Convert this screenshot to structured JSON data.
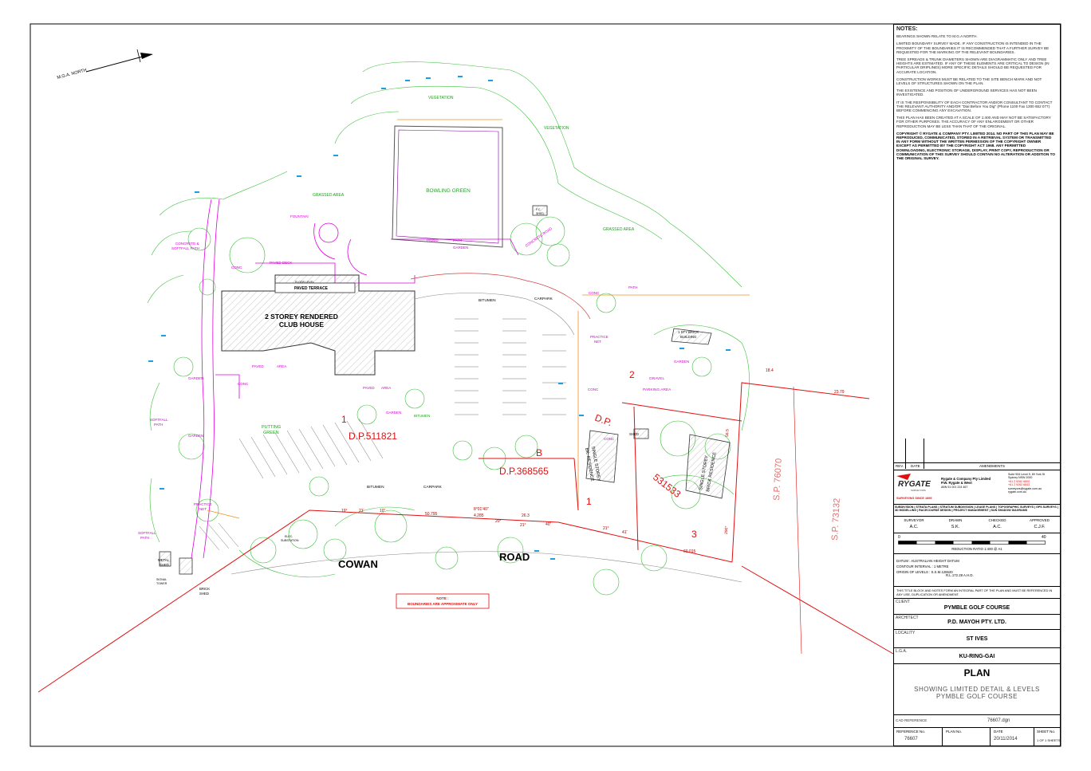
{
  "drawing": {
    "north_label": "M.G.A. NORTH",
    "club_house": [
      "2 STOREY RENDERED",
      "CLUB HOUSE"
    ],
    "paved_terrace": "PAVED TERRACE",
    "floor_level": [
      "FLOOR LEVEL"
    ],
    "bowling_green": "BOWLING GREEN",
    "putting_green": [
      "PUTTING",
      "GREEN"
    ],
    "vegetation": "VEGETATION",
    "grassed_area": "GRASSED AREA",
    "fountain": "FOUNTAIN",
    "paved_deck": "PAVED DECK",
    "paved_path": [
      "PAVED",
      "PATH"
    ],
    "garden": "GARDEN",
    "concrete_softfall_path": [
      "CONCRETE &",
      "SOFTFALL PATH"
    ],
    "softfall_path": [
      "SOFTFALL",
      "PATH"
    ],
    "paved_area": [
      "PAVED",
      "AREA"
    ],
    "conc": "CONC",
    "bitumen": "BITUMEN",
    "carpark": "CARPARK",
    "practice_net": [
      "PRACTICE",
      "NET"
    ],
    "gravel_parking": [
      "GRAVEL",
      "PARKING AREA"
    ],
    "brick_building": [
      "1 STY BRICK",
      "BUILDING"
    ],
    "single_storey_bk": [
      "SINGLE STOREY",
      "BK. RESIDENCE"
    ],
    "single_storey_brick": [
      "SINGLE STOREY",
      "BRICK RESIDENCE"
    ],
    "shed": "SHED",
    "metal_shed": [
      "METAL",
      "SHED"
    ],
    "brick_shed": [
      "BRICK",
      "SHED"
    ],
    "signal_tower": [
      "SIGNAL",
      "TOWER"
    ],
    "elec_substation": [
      "ELEC.",
      "SUBSTATION"
    ],
    "fc_shed": [
      "F.C.",
      "SHED"
    ],
    "concrete_road": "CONCRETE ROAD",
    "path": "PATH",
    "lot1": "1",
    "dp511821": "D.P.511821",
    "lotB": "B",
    "dp368565": "D.P.368565",
    "lot1b": "1",
    "lot2": "2",
    "lot3": "3",
    "dp_label": "D.P.",
    "dp531533": "531533",
    "sp76070": "S.P. 76070",
    "sp73132": "S.P. 73132",
    "cowan": "COWAN",
    "road": "ROAD",
    "note_title": "NOTE :",
    "note_text": "BOUNDARIES ARE APPROXIMATE ONLY",
    "dims": [
      "19°",
      "21'",
      "10\"",
      "50.795",
      "8°01'40\"",
      "4.285",
      "20°",
      "26.3",
      "21°",
      "40\"",
      "21°",
      "41'",
      "60.015",
      "18.4",
      "23.79",
      "56.5",
      "290°"
    ]
  },
  "notes": {
    "heading": "NOTES:",
    "items": [
      "BEARINGS SHOWN RELATE TO M.G.A NORTH.",
      "LIMITED BOUNDARY SURVEY MADE. IF ANY CONSTRUCTION IS INTENDED IN THE PROXIMITY OF THE BOUNDARIES IT IS RECOMMENDED THAT A FURTHER SURVEY BE REQUESTED FOR THE MARKING OF THE RELEVANT BOUNDARIES.",
      "TREE SPREADS & TRUNK DIAMETERS SHOWN ARE DIAGRAMMATIC ONLY AND TREE HEIGHTS ARE ESTIMATED. IF ANY OF THESE ELEMENTS ARE CRITICAL TO DESIGN (IN PARTICULAR DRIPLINES) MORE SPECIFIC DETAILS SHOULD BE REQUESTED FOR ACCURATE LOCATION.",
      "CONSTRUCTION WORKS MUST BE RELATED TO THE SITE BENCH MARK AND NOT LEVELS OF STRUCTURES SHOWN ON THE PLAN.",
      "THE EXISTENCE AND POSITION OF UNDERGROUND SERVICES HAS NOT BEEN INVESTIGATED.",
      "IT IS THE RESPONSIBILITY OF EACH CONTRACTOR AND/OR CONSULTANT TO CONTACT THE RELEVANT AUTHORITY AND/OR \"Dial Before You Dig\" (Phone 1100 Fax 1300 652 077) BEFORE COMMENCING ANY EXCAVATION.",
      "THIS PLAN HAS BEEN CREATED AT A SCALE OF 1:400 AND MAY NOT BE SATISFACTORY FOR OTHER PURPOSES. THE ACCURACY OF ANY ENLARGEMENT OR OTHER REPRODUCTION MAY BE LESS THAN THAT OF THE ORIGINAL."
    ],
    "copyright": "COPYRIGHT © RYGATE & COMPANY PTY. LIMITED 2014. NO PART OF THIS PLAN MAY BE REPRODUCED, COMMUNICATED, STORED IN A RETRIEVAL SYSTEM OR TRANSMITTED IN ANY FORM WITHOUT THE WRITTEN PERMISSION OF THE COPYRIGHT OWNER EXCEPT AS PERMITTED BY THE COPYRIGHT ACT 1968. ANY PERMITTED DOWNLOADING, ELECTRONIC STORAGE, DISPLAY, PRINT COPY, REPRODUCTION OR COMMUNICATION OF THIS SURVEY SHOULD CONTAIN NO ALTERATION OR ADDITION TO THE ORIGINAL SURVEY."
  },
  "titleblock": {
    "rev": "REV.",
    "date_hdr": "DATE",
    "amendments": "AMENDMENTS",
    "company": "Rygate & Company Pty Limited",
    "company2": "P.W. Rygate & West",
    "abn": "ABN 51 001 224 467",
    "logo": "RYGATE",
    "logo_sub": "SURVEYORS",
    "since": "SURVEYING SINCE 1895",
    "address": [
      "Suite 904 Level 9, 89 York St",
      "Sydney NSW 2000"
    ],
    "contacts": [
      "+61 2 9262 6800",
      "+61 2 9262 6843",
      "surveyors@rygate.com.au",
      "rygate.com.au"
    ],
    "services": "SUBDIVISION | STRATA PLANS | STRATUM SUBDIVISION | LEASE PLANS | TOPOGRAPHIC SURVEYS | GPS SURVEYS | 3D MODELLING | RACECOURSE DESIGN | PROJECT MANAGEMENT | SUN SHADOW DIAGRAMS",
    "surveyor_hdr": "SURVEYOR",
    "drawn_hdr": "DRAWN",
    "checked_hdr": "CHECKED",
    "approved_hdr": "APPROVED",
    "surveyor": "A.C.",
    "drawn": "S.K.",
    "checked": "A.C.",
    "approved": "C.J.F.",
    "scale_0": "0",
    "scale_40": "40",
    "reduction": "REDUCTION  RATIO  1:400 @ A1",
    "datum": "DATUM :  AUSTRALIAN HEIGHT DATUM",
    "contour": "CONTOUR INTERVAL :  1 METRE",
    "origin": "ORIGIN OF LEVELS :  S.S.M.126520",
    "origin2": "R.L.172.28  A.H.D.",
    "integral": "THIS TITLE BLOCK AND NOTES FORM AN INTEGRAL PART OF THE PLAN AND MUST BE REFERENCED IN ANY USE, DUPLICATION OR AMENDMENT.",
    "client_label": "CLIENT",
    "client": "PYMBLE GOLF COURSE",
    "architect_label": "ARCHITECT",
    "architect": "P.D. MAYOH PTY. LTD.",
    "locality_label": "LOCALITY",
    "locality": "ST IVES",
    "lga_label": "L.G.A.",
    "lga": "KU-RING-GAI",
    "plan": "PLAN",
    "desc1": "SHOWING LIMITED DETAIL & LEVELS",
    "desc2": "PYMBLE GOLF COURSE",
    "cad_label": "CAD REFERENCE",
    "cad": "76607.dgn",
    "ref_label": "REFERENCE No.",
    "ref": "76607",
    "planno_label": "PLAN No.",
    "date_label": "DATE",
    "date": "20/11/2014",
    "sheet_label": "SHEET No.",
    "sheet": "1",
    "of": "OF",
    "sheets": "1",
    "sheets_label": "SHEETS"
  },
  "colors": {
    "vegetation": "#22b022",
    "paving": "#e000e0",
    "boundary": "#e01010",
    "levels": "#1aa0e0",
    "building": "#555555"
  }
}
